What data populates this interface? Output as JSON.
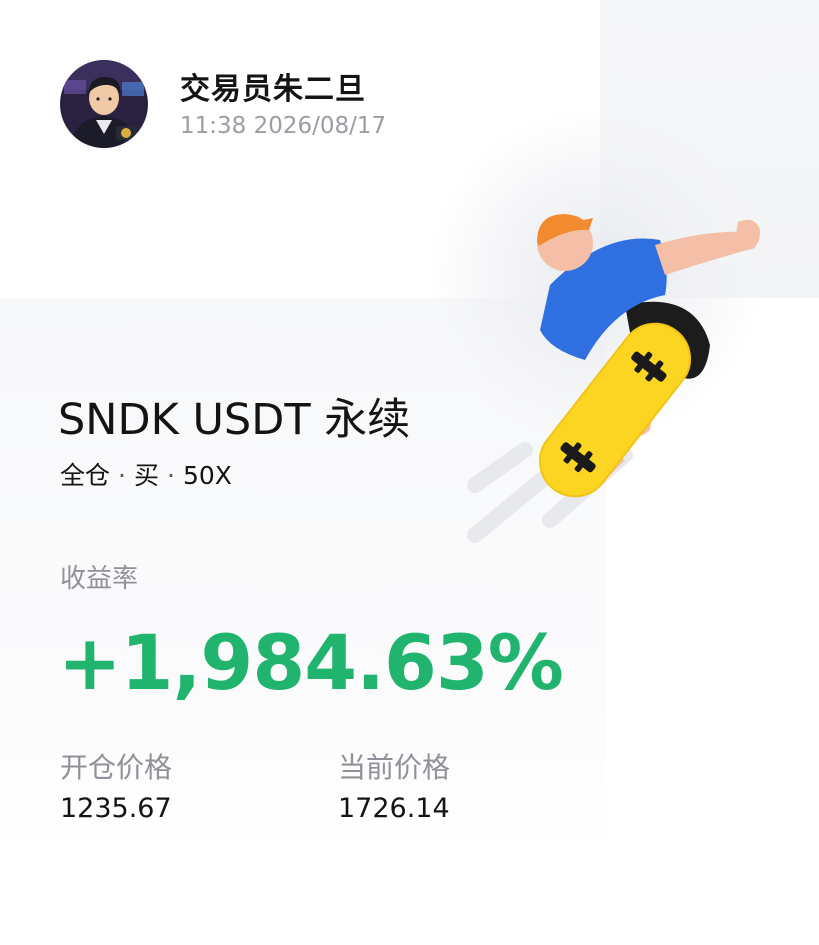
{
  "user": {
    "name": "交易员朱二旦",
    "time": "11:38 2026/08/17"
  },
  "position": {
    "pair": "SNDK USDT 永续",
    "margin_mode": "全仓",
    "direction": "买",
    "leverage": "50X",
    "separator": "·"
  },
  "roi": {
    "label": "收益率",
    "value": "+1,984.63%",
    "color": "#21b46f"
  },
  "prices": {
    "entry_label": "开仓价格",
    "entry_value": "1235.67",
    "current_label": "当前价格",
    "current_value": "1726.14"
  },
  "icons": {
    "avatar": "trader-avatar",
    "illustration": "skateboarder-illustration"
  }
}
